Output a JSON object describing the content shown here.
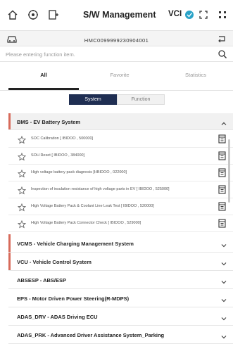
{
  "topbar": {
    "title": "S/W Management",
    "vci_label": "VCI",
    "icons": [
      "home-icon",
      "diagnosis-icon",
      "vehicle-info-icon",
      "vci-status-icon",
      "expand-icon",
      "menu-grid-icon"
    ]
  },
  "infobar": {
    "vin": "HMC0099999230904001",
    "icons": [
      "car-icon",
      "return-icon"
    ]
  },
  "search": {
    "placeholder": "Please entering function item.",
    "icon": "search-icon"
  },
  "tabs": [
    {
      "label": "All",
      "active": true
    },
    {
      "label": "Favorite",
      "active": false
    },
    {
      "label": "Statistics",
      "active": false
    }
  ],
  "segment": {
    "system_label": "System",
    "function_label": "Function",
    "selected": "System"
  },
  "systems": [
    {
      "name": "BMS - EV Battery System",
      "expanded": true,
      "accent": "#d76a5a",
      "functions": [
        "SOC Calibration [ IBIDOO , 500000]",
        "SOH Reset [ IBIDOO , 384000]",
        "High voltage battery pack diagnosis [HBIDOO , 022000]",
        "Inspection of insulation resistance of high voltage parts in EV [ IBIDOO , 525000]",
        "High Voltage Battery Pack & Coolant Line Leak Test [ IBIDOO , 520000]",
        "High Voltage Battery Pack Connector Check [ IBIDOO , 529000]"
      ]
    },
    {
      "name": "VCMS - Vehicle Charging Management System",
      "accent": "#d76a5a"
    },
    {
      "name": "VCU - Vehicle Control System",
      "accent": "#d76a5a"
    },
    {
      "name": "ABSESP - ABS/ESP",
      "accent": ""
    },
    {
      "name": "EPS - Motor Driven Power Steering(R-MDPS)",
      "accent": ""
    },
    {
      "name": "ADAS_DRV - ADAS Driving ECU",
      "accent": ""
    },
    {
      "name": "ADAS_PRK - Advanced Driver Assistance System_Parking",
      "accent": ""
    }
  ],
  "colors": {
    "accent": "#d76a5a",
    "segment_active": "#1f2e52",
    "vci_status": "#2aa3c8"
  }
}
